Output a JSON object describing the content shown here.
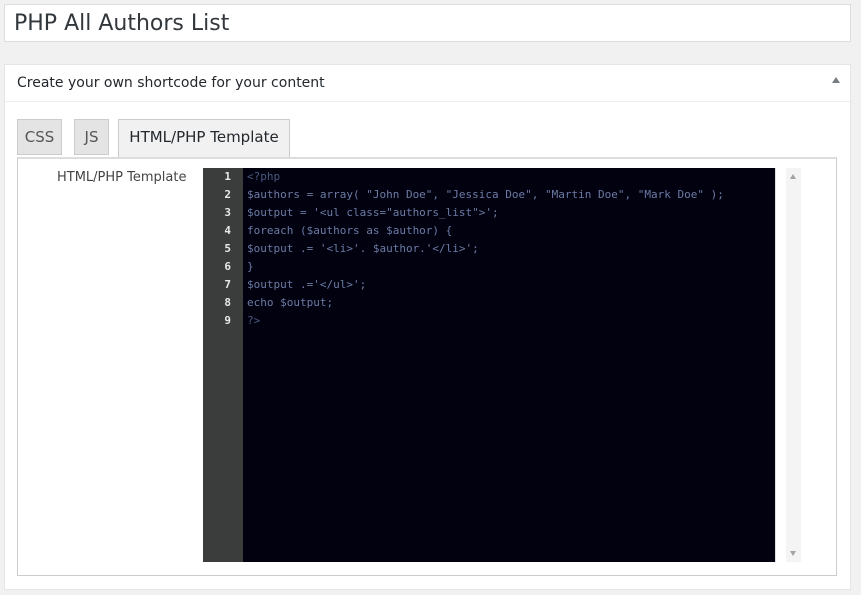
{
  "page": {
    "title": "PHP All Authors List"
  },
  "panel": {
    "title": "Create your own shortcode for your content",
    "collapse_icon": "triangle-up-icon"
  },
  "tabs": [
    {
      "label": "CSS",
      "active": false
    },
    {
      "label": "JS",
      "active": false
    },
    {
      "label": "HTML/PHP Template",
      "active": true
    }
  ],
  "field": {
    "label": "HTML/PHP Template"
  },
  "editor": {
    "background": "#01010f",
    "gutter_background": "#3b3d3d",
    "text_color": "#6c7ca5",
    "line_numbers": [
      "1",
      "2",
      "3",
      "4",
      "5",
      "6",
      "7",
      "8",
      "9"
    ],
    "lines": [
      "<?php",
      "$authors = array( \"John Doe\", \"Jessica Doe\", \"Martin Doe\", \"Mark Doe\" );",
      "$output = '<ul class=\"authors_list\">';",
      "foreach ($authors as $author) {",
      "$output .= '<li>'. $author.'</li>';",
      "}",
      "$output .='</ul>';",
      "echo $output;",
      "?>"
    ]
  },
  "scrollbar": {
    "up_icon": "scroll-up-arrow-icon",
    "down_icon": "scroll-down-arrow-icon"
  }
}
